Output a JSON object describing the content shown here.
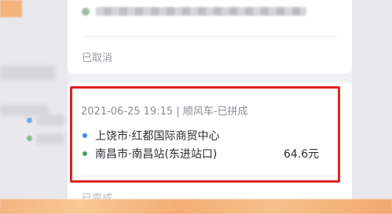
{
  "top_card": {
    "status_text": "已取消"
  },
  "order": {
    "header": "2021-06-25 19:15 | 顺风车-已拼成",
    "start_location": "上饶市·红都国际商贸中心",
    "end_location": "南昌市·南昌站(东进站口)",
    "price": "64.6元"
  },
  "next_card": {
    "status_text": "已完成"
  },
  "colors": {
    "highlight_border": "#e0241d",
    "start_dot": "#3d8be6",
    "end_dot": "#32a565",
    "page_background": "#f0eff3"
  },
  "icons": {
    "start_marker": "blue-dot-icon",
    "end_marker": "green-dot-icon"
  }
}
